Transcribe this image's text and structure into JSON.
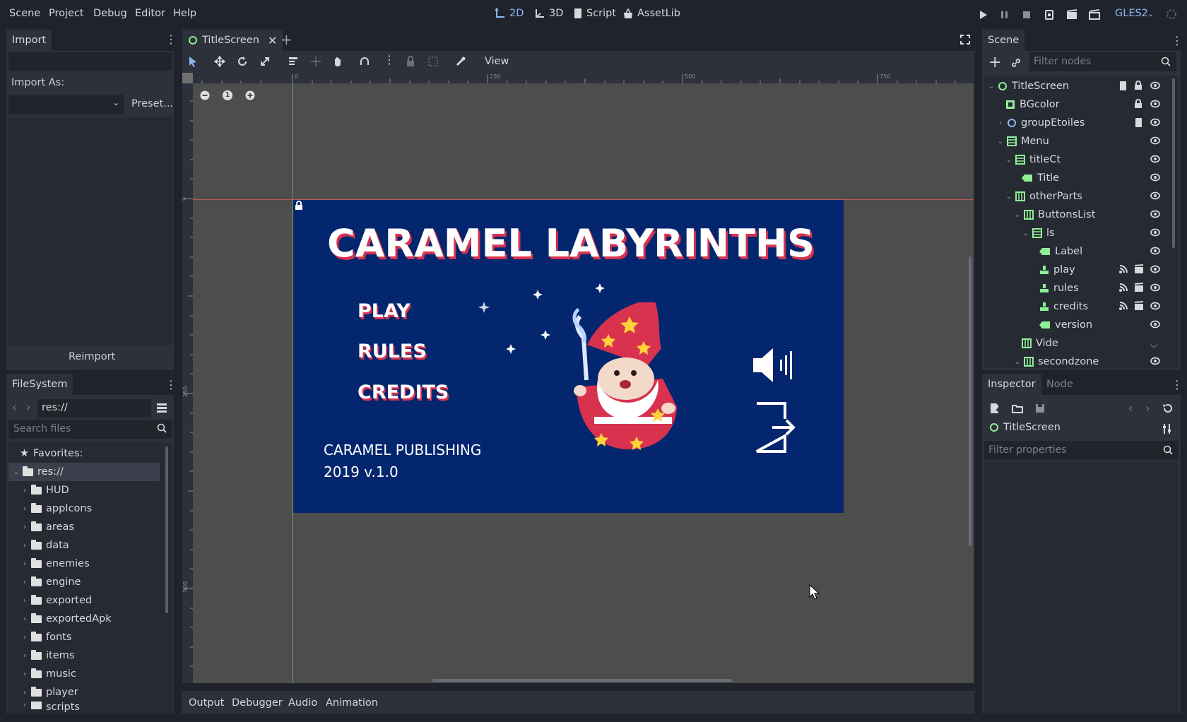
{
  "menu": [
    "Scene",
    "Project",
    "Debug",
    "Editor",
    "Help"
  ],
  "workspaces": {
    "w2d": "2D",
    "w3d": "3D",
    "script": "Script",
    "assetlib": "AssetLib"
  },
  "renderer": "GLES2",
  "import_panel": {
    "tab": "Import",
    "import_as_label": "Import As:",
    "preset_label": "Preset...",
    "reimport_label": "Reimport"
  },
  "filesystem": {
    "tab": "FileSystem",
    "path": "res://",
    "search_placeholder": "Search files",
    "favorites_label": "Favorites:",
    "root": "res://",
    "folders": [
      "HUD",
      "appIcons",
      "areas",
      "data",
      "enemies",
      "engine",
      "exported",
      "exportedApk",
      "fonts",
      "items",
      "music",
      "player",
      "scripts"
    ]
  },
  "editor": {
    "tab_title": "TitleScreen",
    "view_menu": "View",
    "ruler_top": [
      "0",
      "250",
      "500",
      "750"
    ],
    "ruler_left": [
      "0",
      "250",
      "500"
    ],
    "zoom_reset": "1"
  },
  "game_screen": {
    "title": "CARAMEL LABYRINTHS",
    "buttons": [
      "PLAY",
      "RULES",
      "CREDITS"
    ],
    "publisher": "CARAMEL PUBLISHING",
    "version": "2019 v.1.0",
    "bg_color": "#03266e"
  },
  "scene_panel": {
    "tab": "Scene",
    "filter_placeholder": "Filter nodes",
    "nodes": [
      {
        "name": "TitleScreen",
        "depth": 0,
        "arrow": "down",
        "icon": "control-circle-icon"
      },
      {
        "name": "BGcolor",
        "depth": 1,
        "arrow": "",
        "icon": "colorrect-icon"
      },
      {
        "name": "groupEtoiles",
        "depth": 1,
        "arrow": "right",
        "icon": "control-circle-icon"
      },
      {
        "name": "Menu",
        "depth": 1,
        "arrow": "down",
        "icon": "vbox-icon"
      },
      {
        "name": "titleCt",
        "depth": 2,
        "arrow": "down",
        "icon": "vbox-icon"
      },
      {
        "name": "Title",
        "depth": 3,
        "arrow": "",
        "icon": "label-icon"
      },
      {
        "name": "otherParts",
        "depth": 2,
        "arrow": "down",
        "icon": "hbox-icon"
      },
      {
        "name": "ButtonsList",
        "depth": 3,
        "arrow": "down",
        "icon": "hbox-icon"
      },
      {
        "name": "ls",
        "depth": 4,
        "arrow": "down",
        "icon": "vbox-icon"
      },
      {
        "name": "Label",
        "depth": 5,
        "arrow": "",
        "icon": "label-icon"
      },
      {
        "name": "play",
        "depth": 5,
        "arrow": "",
        "icon": "texturebutton-icon"
      },
      {
        "name": "rules",
        "depth": 5,
        "arrow": "",
        "icon": "texturebutton-icon"
      },
      {
        "name": "credits",
        "depth": 5,
        "arrow": "",
        "icon": "texturebutton-icon"
      },
      {
        "name": "version",
        "depth": 5,
        "arrow": "",
        "icon": "label-icon"
      },
      {
        "name": "Vide",
        "depth": 3,
        "arrow": "",
        "icon": "hbox-icon"
      },
      {
        "name": "secondzone",
        "depth": 3,
        "arrow": "down",
        "icon": "hbox-icon"
      }
    ]
  },
  "inspector": {
    "tab": "Inspector",
    "tab_node": "Node",
    "object": "TitleScreen",
    "filter_placeholder": "Filter properties"
  },
  "bottom_tabs": [
    "Output",
    "Debugger",
    "Audio",
    "Animation"
  ],
  "colors": {
    "accent": "#8db6f2",
    "bg": "#20232b",
    "panel": "#2d313b",
    "viewport": "#4d4d4d",
    "node_green": "#8eef97"
  }
}
